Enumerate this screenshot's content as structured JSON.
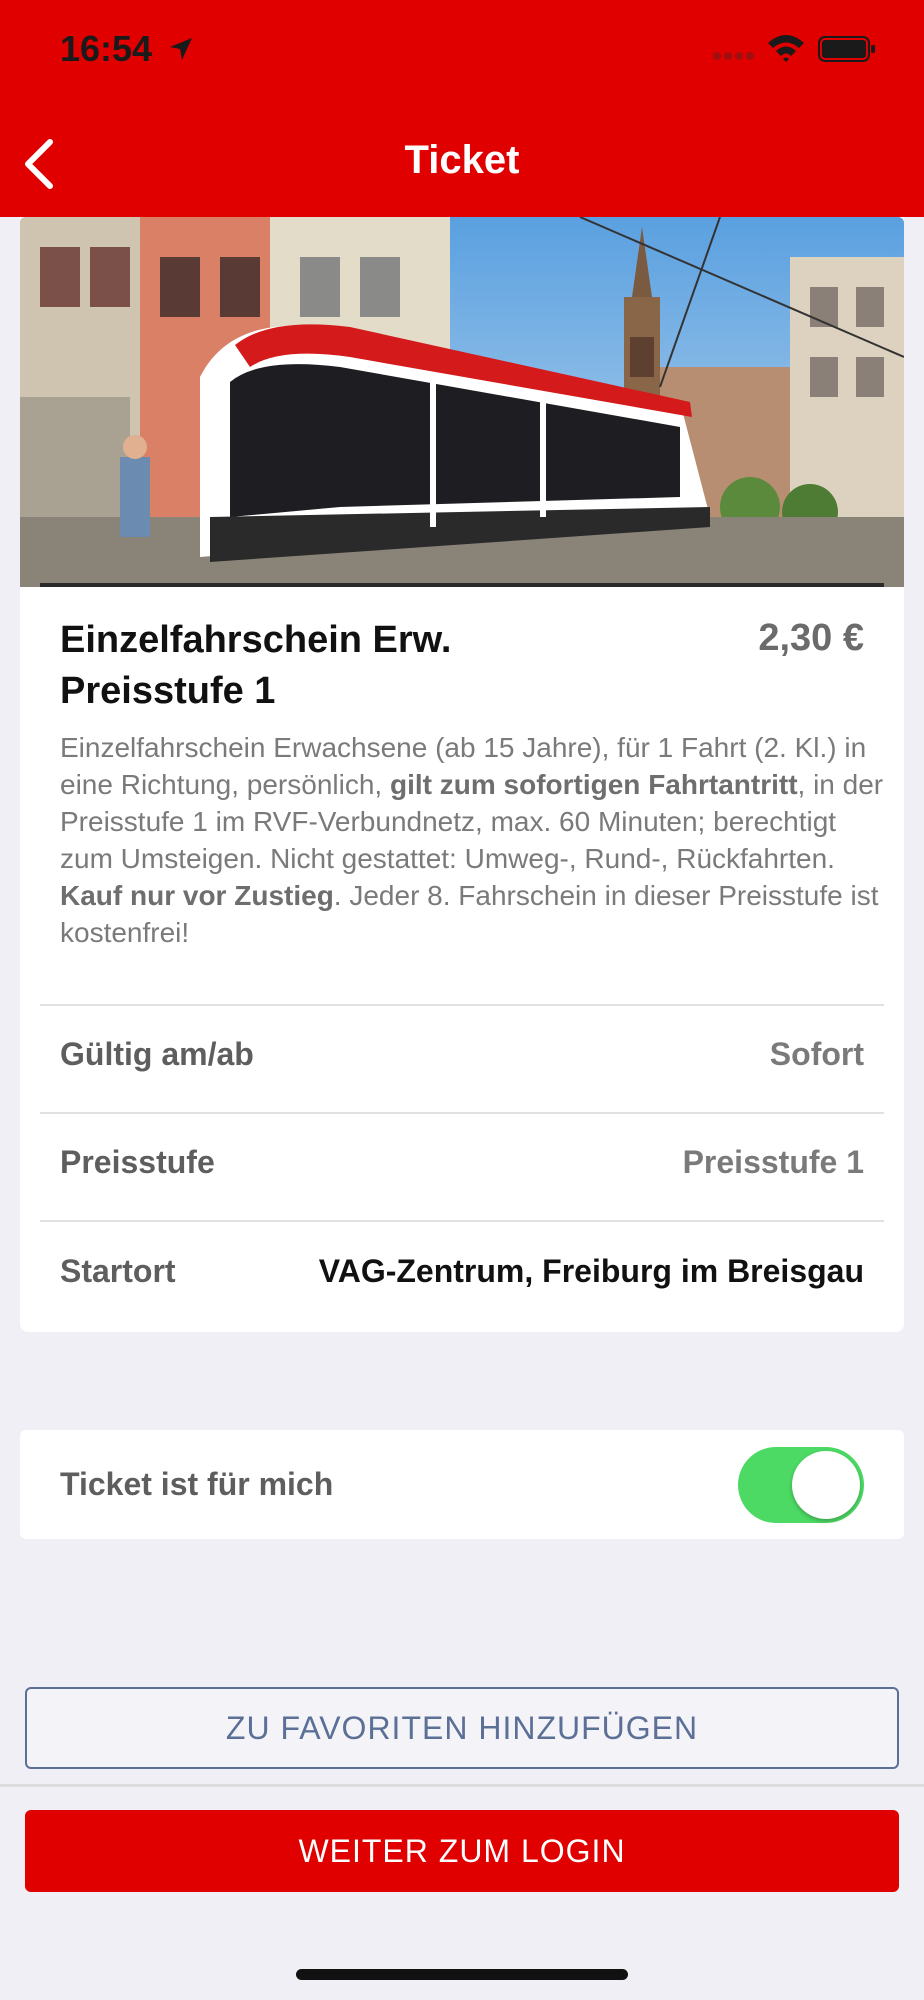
{
  "status_bar": {
    "time": "16:54"
  },
  "header": {
    "title": "Ticket"
  },
  "ticket": {
    "title_line1": "Einzelfahrschein Erw.",
    "title_line2": "Preisstufe 1",
    "price": "2,30 €",
    "description": [
      {
        "text": "Einzelfahrschein Erwachsene (ab 15 Jahre), für 1 Fahrt (2. Kl.) in eine Richtung, persönlich, ",
        "bold": false
      },
      {
        "text": "gilt zum sofortigen Fahrtantritt",
        "bold": true
      },
      {
        "text": ", in der Preisstufe 1 im RVF-Verbundnetz, max. 60 Minuten; berechtigt zum Umsteigen. Nicht gestattet: Umweg-, Rund-, Rückfahrten. ",
        "bold": false
      },
      {
        "text": "Kauf nur vor Zustieg",
        "bold": true
      },
      {
        "text": ". Jeder 8. Fahrschein in dieser Preisstufe ist kostenfrei!",
        "bold": false
      }
    ],
    "details": [
      {
        "label": "Gültig am/ab",
        "value": "Sofort"
      },
      {
        "label": "Preisstufe",
        "value": "Preisstufe 1"
      },
      {
        "label": "Startort",
        "value": "VAG-Zentrum, Freiburg im Breisgau"
      }
    ]
  },
  "toggle": {
    "label": "Ticket ist für mich",
    "on": true
  },
  "buttons": {
    "favorite": "ZU FAVORITEN HINZUFÜGEN",
    "login": "WEITER ZUM LOGIN"
  },
  "colors": {
    "brand_red": "#e00000",
    "toggle_green": "#4cd964",
    "link_blue": "#5c6f96"
  }
}
